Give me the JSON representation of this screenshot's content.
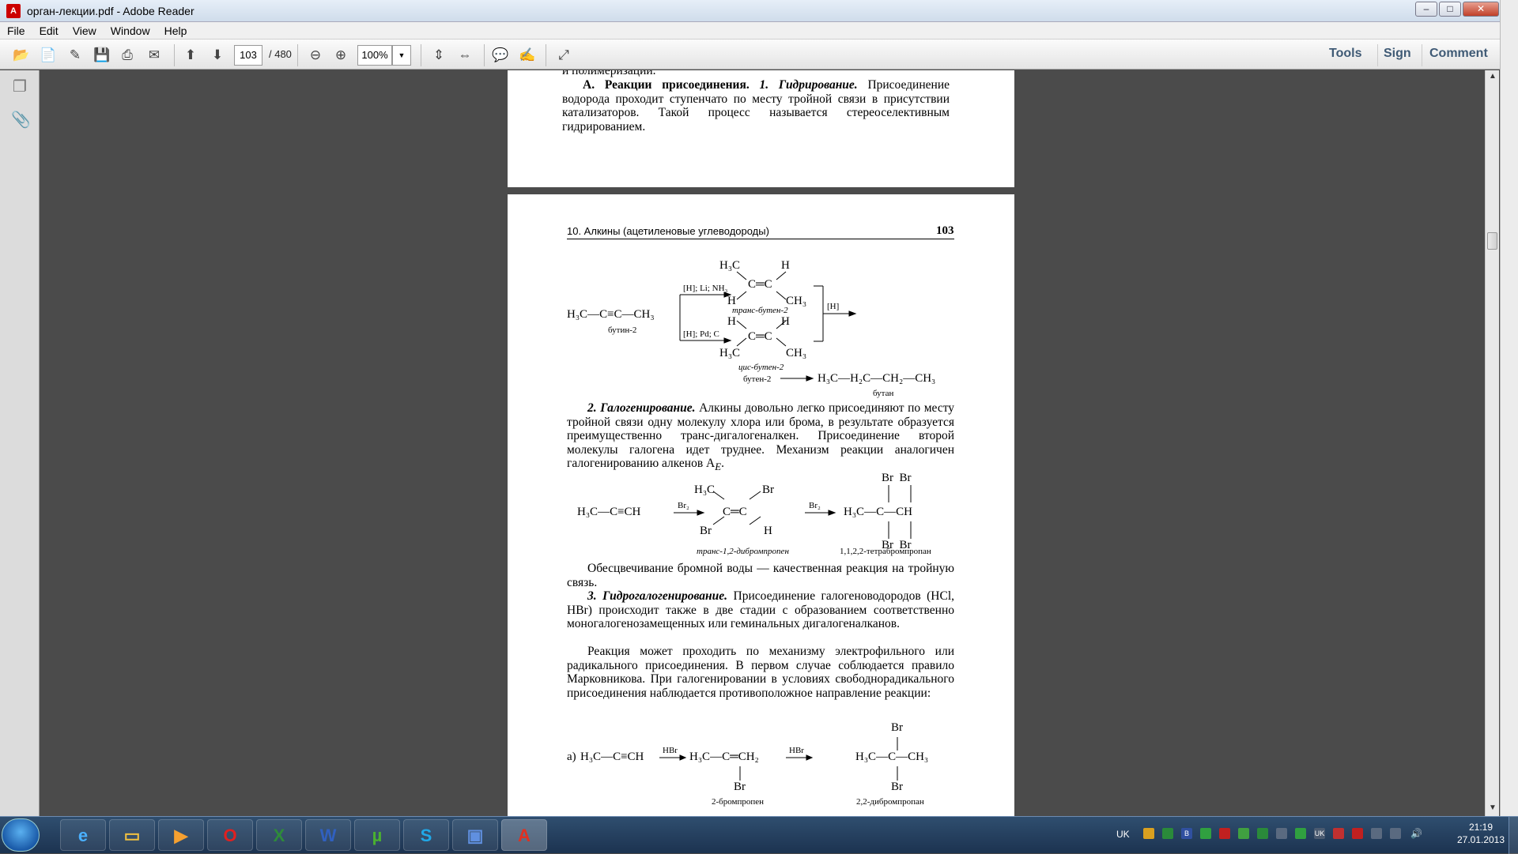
{
  "window": {
    "title": "орган-лекции.pdf - Adobe Reader",
    "minimize": "–",
    "maximize": "□",
    "close": "✕"
  },
  "menu": [
    "File",
    "Edit",
    "View",
    "Window",
    "Help"
  ],
  "toolbar": {
    "page_current": "103",
    "page_total": "/ 480",
    "zoom": "100%",
    "tools": "Tools",
    "sign": "Sign",
    "comment": "Comment"
  },
  "icons": [
    "open-icon",
    "create-pdf-icon",
    "edit-icon",
    "save-icon",
    "print-icon",
    "email-icon",
    "prev-page-icon",
    "next-page-icon",
    "zoom-out-icon",
    "zoom-in-icon",
    "fit-page-icon",
    "fit-width-icon",
    "comment-icon",
    "highlight-icon",
    "expand-icon",
    "pages-panel-icon",
    "attachments-icon"
  ],
  "page_top": {
    "line0": "и полимеризации.",
    "para": [
      "А. Реакции присоединения.",
      "1. Гидрирование.",
      "Присоединение водорода проходит ступенчато по месту тройной связи в присутствии катализаторов. Такой процесс называется стереоселективным гидрированием."
    ]
  },
  "page_main": {
    "header": "10. Алкины (ацетиленовые углеводороды)",
    "page_number": "103",
    "scheme1": {
      "butyne": "H₃C—C≡C—CH₃",
      "butyne_name": "бутин-2",
      "cond_top": "[H]; Li; NH₃",
      "cond_bot": "[H]; Pd; C",
      "cond_right": "[H]",
      "trans_name": "транс-бутен-2",
      "cis_name": "цис-бутен-2",
      "butene": "бутен-2",
      "product": "H₃C—H₂C—CH₂—CH₃",
      "product_name": "бутан"
    },
    "para2_head": "2. Галогенирование.",
    "para2": "Алкины довольно легко присоединяют по месту тройной связи одну молекулу хлора или брома, в результате образуется преимущественно транс-дигалогеналкен. Присоединение второй молекулы галогена идет труднее. Механизм реакции аналогичен галогенированию алкенов A",
    "para2_sub": "E",
    "scheme2": {
      "reactant": "H₃C—C≡CH",
      "reagent": "Br₂",
      "mid_name": "транс-1,2-дибромпропен",
      "final_name": "1,1,2,2-тетрабромпропан"
    },
    "para3": "Обесцвечивание бромной воды — качественная реакция на тройную связь.",
    "para4_head": "3. Гидрогалогенирование.",
    "para4": "Присоединение галогеноводородов (HCl, HBr) происходит также в две стадии с образованием соответственно моногалогенозамещенных или геминальных дигалогеналканов.",
    "para5": "Реакция может проходить по механизму электрофильного или радикального присоединения. В первом случае соблюдается правило Марковникова. При галогенировании в условиях свободнорадикального присоединения наблюдается противоположное направление реакции:",
    "scheme3": {
      "label": "а)",
      "reactant": "H₃C—C≡CH",
      "reagent": "HBr",
      "mid": "H₃C—C═CH₂",
      "mid_sub": "Br",
      "mid_name": "2-бромпропен",
      "final": "H₃C—C—CH₃",
      "final_name": "2,2-дибромпропан",
      "br": "Br"
    }
  },
  "taskbar": {
    "apps": [
      "ie-icon",
      "explorer-icon",
      "media-player-icon",
      "opera-icon",
      "excel-icon",
      "word-icon",
      "utorrent-icon",
      "skype-icon",
      "save-app-icon",
      "acrobat-icon"
    ],
    "lang": "UK",
    "time": "21:19",
    "date": "27.01.2013"
  },
  "colors": {
    "doc_bg": "#4b4b4b",
    "taskbar": "#1c3350",
    "accent": "#3f5a75"
  }
}
